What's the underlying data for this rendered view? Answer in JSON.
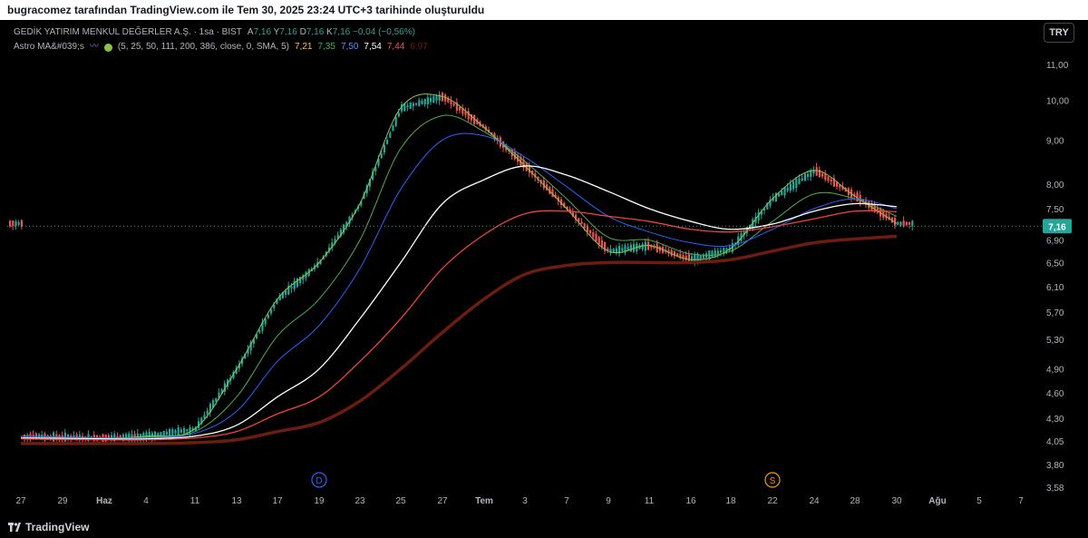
{
  "header": {
    "caption": "bugracomez tarafından TradingView.com ile Tem 30, 2025 23:24 UTC+3 tarihinde oluşturuldu"
  },
  "legend": {
    "symbol": "GEDİK YATIRIM MENKUL DEĞERLER A.Ş. · 1sa · BIST",
    "open_label": "A",
    "open": "7,16",
    "high_label": "Y",
    "high": "7,16",
    "low_label": "D",
    "low": "7,16",
    "close_label": "K",
    "close": "7,16",
    "change": "−0,04 (−0,56%)",
    "indicator_name": "Astro MA&#039;s",
    "indicator_params": "(5, 25, 50, 111, 200, 386, close, 0, SMA, 5)",
    "ma_values": [
      "7,21",
      "7,35",
      "7,50",
      "7,54",
      "7,44",
      "6,97"
    ]
  },
  "currency_button": "TRY",
  "footer": {
    "brand": "TradingView"
  },
  "colors": {
    "up": "#26a69a",
    "down": "#ef5350",
    "ma5": "#8bc34a",
    "ma25": "#4caf50",
    "ma50": "#2962ff",
    "ma111": "#ffffff",
    "ma200": "#f44336",
    "ma386": "#6d1c10"
  },
  "chart_data": {
    "type": "line",
    "title": "GEDİK YATIRIM MENKUL DEĞERLER A.Ş. · 1sa · BIST",
    "y_scale": "log",
    "ylim": [
      3.58,
      11.4
    ],
    "y_ticks": [
      "11,00",
      "10,00",
      "9,00",
      "8,00",
      "7,50",
      "6,90",
      "6,50",
      "6,10",
      "5,70",
      "5,30",
      "4,90",
      "4,60",
      "4,30",
      "4,05",
      "3,80",
      "3,58"
    ],
    "y_tick_values": [
      11.0,
      10.0,
      9.0,
      8.0,
      7.5,
      6.9,
      6.5,
      6.1,
      5.7,
      5.3,
      4.9,
      4.6,
      4.3,
      4.05,
      3.8,
      3.58
    ],
    "x_ticks": [
      "27",
      "29",
      "Haz",
      "4",
      "11",
      "13",
      "17",
      "19",
      "23",
      "25",
      "27",
      "Tem",
      "3",
      "7",
      "9",
      "11",
      "16",
      "18",
      "22",
      "24",
      "28",
      "30",
      "Ağu",
      "5",
      "7"
    ],
    "last_price_label": "7,16",
    "last_price": 7.16,
    "events": [
      {
        "label": "D",
        "at_tick": "19",
        "color": "#2962ff"
      },
      {
        "label": "S",
        "at_tick": "22",
        "color": "#ff9800"
      }
    ],
    "series": [
      {
        "name": "MA 5",
        "color": "#8bc34a",
        "x": [
          "27",
          "Haz",
          "4",
          "11",
          "13",
          "17",
          "19",
          "23",
          "25",
          "27",
          "Tem",
          "3",
          "7",
          "9",
          "11",
          "16",
          "18",
          "22",
          "24",
          "28",
          "30"
        ],
        "values": [
          4.1,
          4.08,
          4.1,
          4.18,
          4.9,
          5.9,
          6.5,
          7.6,
          9.8,
          10.1,
          9.3,
          8.4,
          7.5,
          6.7,
          6.8,
          6.55,
          6.75,
          7.7,
          8.3,
          7.75,
          7.21
        ]
      },
      {
        "name": "MA 25",
        "color": "#4caf50",
        "x": [
          "27",
          "Haz",
          "4",
          "11",
          "13",
          "17",
          "19",
          "23",
          "25",
          "27",
          "Tem",
          "3",
          "7",
          "9",
          "11",
          "16",
          "18",
          "22",
          "24",
          "28",
          "30"
        ],
        "values": [
          4.1,
          4.08,
          4.09,
          4.15,
          4.55,
          5.35,
          5.9,
          6.9,
          8.8,
          9.6,
          9.2,
          8.5,
          7.7,
          6.95,
          6.9,
          6.65,
          6.7,
          7.25,
          7.8,
          7.7,
          7.35
        ]
      },
      {
        "name": "MA 50",
        "color": "#2962ff",
        "x": [
          "27",
          "Haz",
          "4",
          "11",
          "13",
          "17",
          "19",
          "23",
          "25",
          "27",
          "Tem",
          "3",
          "7",
          "9",
          "11",
          "16",
          "18",
          "22",
          "24",
          "28",
          "30"
        ],
        "values": [
          4.1,
          4.08,
          4.08,
          4.13,
          4.38,
          5.0,
          5.5,
          6.4,
          7.9,
          9.0,
          9.1,
          8.6,
          7.95,
          7.35,
          7.05,
          6.85,
          6.8,
          7.1,
          7.5,
          7.7,
          7.5
        ]
      },
      {
        "name": "MA 111",
        "color": "#ffffff",
        "x": [
          "27",
          "Haz",
          "4",
          "11",
          "13",
          "17",
          "19",
          "23",
          "25",
          "27",
          "Tem",
          "3",
          "7",
          "9",
          "11",
          "16",
          "18",
          "22",
          "24",
          "28",
          "30"
        ],
        "values": [
          4.08,
          4.07,
          4.07,
          4.1,
          4.22,
          4.55,
          4.9,
          5.6,
          6.5,
          7.6,
          8.1,
          8.4,
          8.2,
          7.85,
          7.5,
          7.25,
          7.1,
          7.2,
          7.45,
          7.6,
          7.54
        ]
      },
      {
        "name": "MA 200",
        "color": "#f44336",
        "x": [
          "27",
          "Haz",
          "4",
          "11",
          "13",
          "17",
          "19",
          "23",
          "25",
          "27",
          "Tem",
          "3",
          "7",
          "9",
          "11",
          "16",
          "18",
          "22",
          "24",
          "28",
          "30"
        ],
        "values": [
          4.07,
          4.06,
          4.06,
          4.08,
          4.15,
          4.35,
          4.55,
          5.0,
          5.6,
          6.4,
          7.0,
          7.4,
          7.45,
          7.35,
          7.25,
          7.1,
          7.05,
          7.15,
          7.3,
          7.45,
          7.44
        ]
      },
      {
        "name": "MA 386",
        "color": "#6d1c10",
        "x": [
          "27",
          "Haz",
          "4",
          "11",
          "13",
          "17",
          "19",
          "23",
          "25",
          "27",
          "Tem",
          "3",
          "7",
          "9",
          "11",
          "16",
          "18",
          "22",
          "24",
          "28",
          "30"
        ],
        "values": [
          4.02,
          4.02,
          4.02,
          4.03,
          4.06,
          4.15,
          4.25,
          4.5,
          4.9,
          5.4,
          5.9,
          6.3,
          6.45,
          6.5,
          6.5,
          6.5,
          6.55,
          6.7,
          6.85,
          6.92,
          6.97
        ]
      }
    ]
  }
}
